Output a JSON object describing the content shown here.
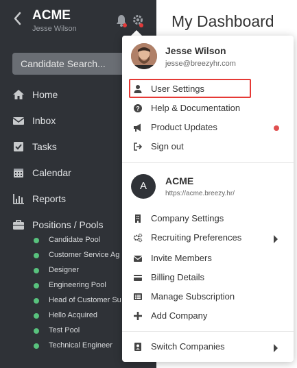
{
  "sidebar": {
    "company_name": "ACME",
    "user_name": "Jesse Wilson",
    "search_placeholder": "Candidate Search...",
    "nav": [
      {
        "label": "Home",
        "icon": "home-icon"
      },
      {
        "label": "Inbox",
        "icon": "envelope-icon"
      },
      {
        "label": "Tasks",
        "icon": "checkbox-icon"
      },
      {
        "label": "Calendar",
        "icon": "calendar-icon"
      },
      {
        "label": "Reports",
        "icon": "bar-chart-icon"
      },
      {
        "label": "Positions / Pools",
        "icon": "briefcase-icon"
      }
    ],
    "pools": [
      "Candidate Pool",
      "Customer Service Ag",
      "Designer",
      "Engineering Pool",
      "Head of Customer Su",
      "Hello Acquired",
      "Test Pool",
      "Technical Engineer"
    ]
  },
  "main": {
    "title": "My Dashboard"
  },
  "dropdown": {
    "profile": {
      "name": "Jesse Wilson",
      "email": "jesse@breezyhr.com"
    },
    "user_menu": [
      {
        "label": "User Settings",
        "icon": "user-icon"
      },
      {
        "label": "Help & Documentation",
        "icon": "question-circle-icon"
      },
      {
        "label": "Product Updates",
        "icon": "megaphone-icon"
      },
      {
        "label": "Sign out",
        "icon": "sign-out-icon"
      }
    ],
    "company": {
      "avatar_letter": "A",
      "name": "ACME",
      "url": "https://acme.breezy.hr/"
    },
    "company_menu": [
      {
        "label": "Company Settings",
        "icon": "building-icon"
      },
      {
        "label": "Recruiting Preferences",
        "icon": "cogs-icon"
      },
      {
        "label": "Invite Members",
        "icon": "envelope-icon"
      },
      {
        "label": "Billing Details",
        "icon": "credit-card-icon"
      },
      {
        "label": "Manage Subscription",
        "icon": "list-icon"
      },
      {
        "label": "Add Company",
        "icon": "plus-icon"
      }
    ],
    "switch": {
      "label": "Switch Companies",
      "icon": "id-card-icon"
    }
  },
  "colors": {
    "sidebar_bg": "#2f3237",
    "pool_dot": "#58c27d",
    "highlight": "#e53935",
    "notification_dot": "#e23a3a"
  }
}
